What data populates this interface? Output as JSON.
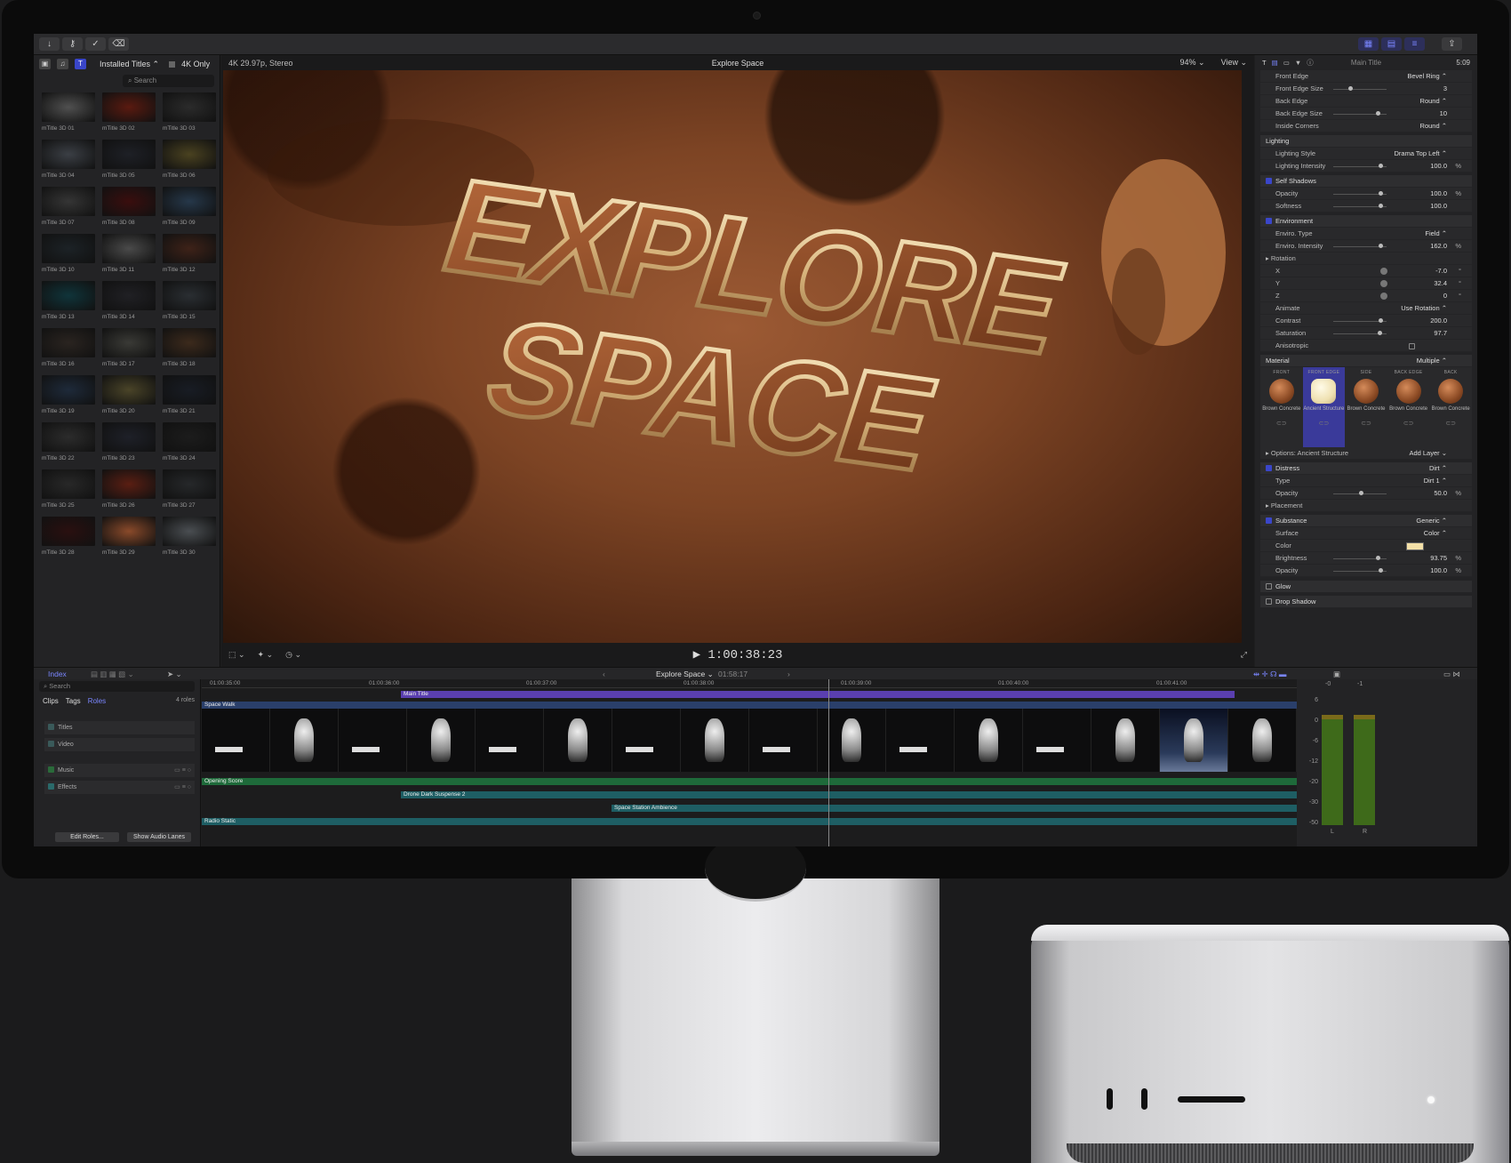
{
  "toolbar": {
    "buttons": [
      "↓",
      "⚷",
      "✓",
      "⌫"
    ],
    "right_buttons": [
      "▦",
      "▤",
      "≡",
      "⇪"
    ]
  },
  "browser": {
    "source_label": "Installed Titles ⌃",
    "filter_label": "4K Only",
    "search_placeholder": "Search",
    "thumbs": [
      {
        "label": "mTitle 3D 01",
        "color": "#505050"
      },
      {
        "label": "mTitle 3D 02",
        "color": "#5a1a10"
      },
      {
        "label": "mTitle 3D 03",
        "color": "#2b2b2b"
      },
      {
        "label": "mTitle 3D 04",
        "color": "#3b3f45"
      },
      {
        "label": "mTitle 3D 05",
        "color": "#1e2026"
      },
      {
        "label": "mTitle 3D 06",
        "color": "#4a4220"
      },
      {
        "label": "mTitle 3D 07",
        "color": "#353535"
      },
      {
        "label": "mTitle 3D 08",
        "color": "#3a0e0e"
      },
      {
        "label": "mTitle 3D 09",
        "color": "#26384a"
      },
      {
        "label": "mTitle 3D 10",
        "color": "#1c2226"
      },
      {
        "label": "mTitle 3D 11",
        "color": "#4a4a4a"
      },
      {
        "label": "mTitle 3D 12",
        "color": "#3e2218"
      },
      {
        "label": "mTitle 3D 13",
        "color": "#10343a"
      },
      {
        "label": "mTitle 3D 14",
        "color": "#202024"
      },
      {
        "label": "mTitle 3D 15",
        "color": "#2a2e32"
      },
      {
        "label": "mTitle 3D 16",
        "color": "#2a2420"
      },
      {
        "label": "mTitle 3D 17",
        "color": "#3a3a36"
      },
      {
        "label": "mTitle 3D 18",
        "color": "#3c2a1c"
      },
      {
        "label": "mTitle 3D 19",
        "color": "#1e2a3a"
      },
      {
        "label": "mTitle 3D 20",
        "color": "#4a4428"
      },
      {
        "label": "mTitle 3D 21",
        "color": "#181c24"
      },
      {
        "label": "mTitle 3D 22",
        "color": "#2c2c2c"
      },
      {
        "label": "mTitle 3D 23",
        "color": "#1e2028"
      },
      {
        "label": "mTitle 3D 24",
        "color": "#1c1c1c"
      },
      {
        "label": "mTitle 3D 25",
        "color": "#282828"
      },
      {
        "label": "mTitle 3D 26",
        "color": "#5a1e12"
      },
      {
        "label": "mTitle 3D 27",
        "color": "#26282a"
      },
      {
        "label": "mTitle 3D 28",
        "color": "#2a1010"
      },
      {
        "label": "mTitle 3D 29",
        "color": "#8a4a2a"
      },
      {
        "label": "mTitle 3D 30",
        "color": "#4a4e52"
      }
    ]
  },
  "viewer": {
    "format": "4K 29.97p, Stereo",
    "title": "Explore Space",
    "zoom": "94% ⌄",
    "view": "View ⌄",
    "headline_line1": "EXPLORE",
    "headline_line2": "SPACE",
    "timecode": "▶ 1:00:38:23"
  },
  "inspector": {
    "title": "Main Title",
    "duration": "5:09",
    "rows": [
      {
        "label": "Front Edge",
        "value": "Bevel Ring ⌃",
        "kind": "plain"
      },
      {
        "label": "Front Edge Size",
        "value": "3",
        "kind": "slider",
        "level": 0.3
      },
      {
        "label": "Back Edge",
        "value": "Round ⌃",
        "kind": "plain"
      },
      {
        "label": "Back Edge Size",
        "value": "10",
        "kind": "slider",
        "level": 0.85
      },
      {
        "label": "Inside Corners",
        "value": "Round ⌃",
        "kind": "plain"
      },
      {
        "label": "Lighting",
        "value": "",
        "kind": "section"
      },
      {
        "label": "Lighting Style",
        "value": "Drama Top Left ⌃",
        "kind": "plain"
      },
      {
        "label": "Lighting Intensity",
        "value": "100.0",
        "unit": "%",
        "kind": "slider",
        "level": 0.9
      },
      {
        "label": "Self Shadows",
        "value": "",
        "kind": "section-check"
      },
      {
        "label": "Opacity",
        "value": "100.0",
        "unit": "%",
        "kind": "slider",
        "level": 0.9
      },
      {
        "label": "Softness",
        "value": "100.0",
        "kind": "slider",
        "level": 0.9
      },
      {
        "label": "Environment",
        "value": "",
        "kind": "section-check"
      },
      {
        "label": "Enviro. Type",
        "value": "Field ⌃",
        "kind": "plain"
      },
      {
        "label": "Enviro. Intensity",
        "value": "162.0",
        "unit": "%",
        "kind": "slider",
        "level": 0.9
      },
      {
        "label": "Rotation",
        "value": "",
        "kind": "sub"
      },
      {
        "label": "X",
        "value": "-7.0",
        "unit": "°",
        "kind": "dial"
      },
      {
        "label": "Y",
        "value": "32.4",
        "unit": "°",
        "kind": "dial"
      },
      {
        "label": "Z",
        "value": "0",
        "unit": "°",
        "kind": "dial"
      },
      {
        "label": "Animate",
        "value": "Use Rotation ⌃",
        "kind": "plain"
      },
      {
        "label": "Contrast",
        "value": "200.0",
        "kind": "slider",
        "level": 0.9
      },
      {
        "label": "Saturation",
        "value": "97.7",
        "kind": "slider",
        "level": 0.88
      },
      {
        "label": "Anisotropic",
        "value": "",
        "kind": "plain"
      }
    ],
    "material_label": "Material",
    "material_value": "Multiple ⌃",
    "materials": [
      {
        "tag": "FRONT",
        "name": "Brown Concrete"
      },
      {
        "tag": "FRONT EDGE",
        "name": "Ancient Structure"
      },
      {
        "tag": "SIDE",
        "name": "Brown Concrete"
      },
      {
        "tag": "BACK EDGE",
        "name": "Brown Concrete"
      },
      {
        "tag": "BACK",
        "name": "Brown Concrete"
      }
    ],
    "rows2": [
      {
        "label": "Options: Ancient Structure",
        "value": "Add Layer ⌄",
        "kind": "sub"
      },
      {
        "label": "Distress",
        "value": "Dirt ⌃",
        "kind": "section-check"
      },
      {
        "label": "Type",
        "value": "Dirt 1 ⌃",
        "kind": "plain"
      },
      {
        "label": "Opacity",
        "value": "50.0",
        "unit": "%",
        "kind": "slider",
        "level": 0.5
      },
      {
        "label": "Placement",
        "value": "",
        "kind": "sub"
      },
      {
        "label": "Substance",
        "value": "Generic ⌃",
        "kind": "section-check"
      },
      {
        "label": "Surface",
        "value": "Color ⌃",
        "kind": "plain"
      },
      {
        "label": "Color",
        "value": "",
        "kind": "color"
      },
      {
        "label": "Brightness",
        "value": "93.75",
        "unit": "%",
        "kind": "slider",
        "level": 0.85
      },
      {
        "label": "Opacity",
        "value": "100.0",
        "unit": "%",
        "kind": "slider",
        "level": 0.9
      }
    ],
    "glow": "Glow",
    "drop_shadow": "Drop Shadow"
  },
  "timeline": {
    "index_label": "Index",
    "project": "Explore Space ⌄",
    "project_duration": "01:58:17",
    "search_placeholder": "Search",
    "tabs": [
      "Clips",
      "Tags",
      "Roles"
    ],
    "roles_count": "4 roles",
    "roles": [
      "Titles",
      "Video",
      "Music",
      "Effects"
    ],
    "edit_roles": "Edit Roles...",
    "show_audio_lanes": "Show Audio Lanes",
    "ruler": [
      "01:00:35:00",
      "01:00:36:00",
      "01:00:37:00",
      "01:00:38:00",
      "01:00:39:00",
      "01:00:40:00",
      "01:00:41:00"
    ],
    "title_clip": "Main Title",
    "video_clip": "Space Walk",
    "audio_clips": [
      "Opening Score",
      "Drone Dark Suspense 2",
      "Space Station Ambience",
      "Radio Static"
    ],
    "meter_scale": [
      "6",
      "0",
      "-6",
      "-12",
      "-20",
      "-30",
      "-50"
    ],
    "meter_top": [
      "-0",
      "-1"
    ],
    "meter_labels": [
      "L",
      "R"
    ]
  }
}
